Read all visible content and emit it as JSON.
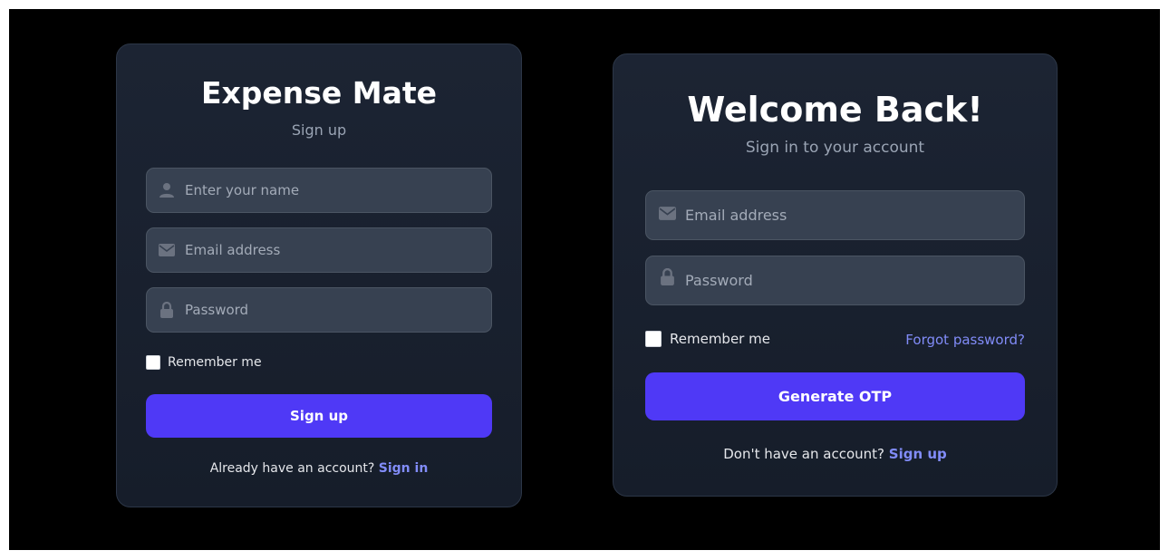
{
  "signup": {
    "title": "Expense Mate",
    "subtitle": "Sign up",
    "name_placeholder": "Enter your name",
    "name_icon": "user-icon",
    "email_placeholder": "Email address",
    "email_icon": "envelope-icon",
    "password_placeholder": "Password",
    "password_icon": "lock-icon",
    "remember_label": "Remember me",
    "submit_label": "Sign up",
    "footer_text": "Already have an account?",
    "footer_link": "Sign in"
  },
  "signin": {
    "title": "Welcome Back!",
    "subtitle": "Sign in to your account",
    "email_placeholder": "Email address",
    "email_icon": "envelope-icon",
    "password_placeholder": "Password",
    "password_icon": "lock-icon",
    "remember_label": "Remember me",
    "forgot_label": "Forgot password?",
    "submit_label": "Generate OTP",
    "footer_text": "Don't have an account?",
    "footer_link": "Sign up"
  },
  "colors": {
    "background": "#000000",
    "card": "#1c2433",
    "input": "#374151",
    "accent": "#4f39f6",
    "link": "#818cf8",
    "muted_text": "#9aa4b4"
  }
}
